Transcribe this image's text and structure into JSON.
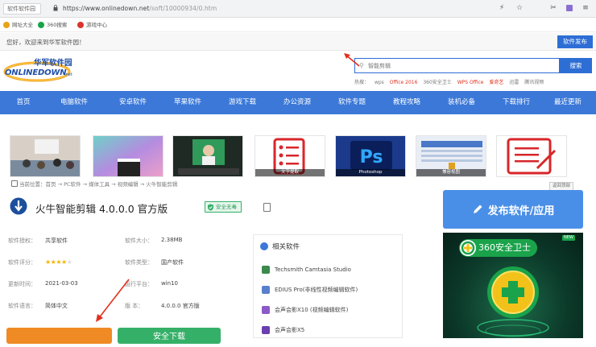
{
  "browser": {
    "tab_label": "软件软件园",
    "url_main": "https://www.onlinedown.net",
    "url_rest": "/soft/10000934/0.htm"
  },
  "bookmarks": [
    {
      "label": "网址大全",
      "color": "#e8a317"
    },
    {
      "label": "360搜索",
      "color": "#1aa34a"
    },
    {
      "label": "游戏中心",
      "color": "#d9342b"
    }
  ],
  "site_topbar": {
    "welcome": "您好，欢迎来到华军软件园！",
    "submit_label": "软件发布"
  },
  "logo": {
    "cn": "华军软件园",
    "en": "ONLINEDOWN",
    "suffix": ".net"
  },
  "search": {
    "placeholder": "智能剪辑",
    "button": "搜索",
    "hot_words": [
      {
        "text": "热搜：",
        "hot": false
      },
      {
        "text": "wps",
        "hot": false
      },
      {
        "text": "Office 2016",
        "hot": true
      },
      {
        "text": "360安全卫士",
        "hot": false
      },
      {
        "text": "WPS Office",
        "hot": true
      },
      {
        "text": "爱奇艺",
        "hot": false
      },
      {
        "text": "迅雷",
        "hot": false
      },
      {
        "text": "腾讯视频",
        "hot": false
      }
    ]
  },
  "nav": [
    "首页",
    "电脑软件",
    "安卓软件",
    "苹果软件",
    "游戏下载",
    "办公资源",
    "软件专题",
    "教程攻略",
    "装机必备",
    "下载排行",
    "最近更新"
  ],
  "banners": [
    {
      "caption": ""
    },
    {
      "caption": ""
    },
    {
      "caption": ""
    },
    {
      "caption": "文字提取"
    },
    {
      "caption": "Photoshop"
    },
    {
      "caption": "兼容视图"
    },
    {
      "caption": ""
    }
  ],
  "breadcrumb": "当前位置：首页 → PC软件 → 媒体工具 → 视频编辑 → 火牛智能剪辑",
  "top_back": "返回顶部",
  "software": {
    "title": "火牛智能剪辑  4.0.0.0 官方版",
    "safe_badge": "安全无毒",
    "rating": 4,
    "rating_max": 5
  },
  "info": [
    {
      "label": "软件授权：",
      "value": "共享软件"
    },
    {
      "label": "软件评分：",
      "value": ""
    },
    {
      "label": "更新时间：",
      "value": "2021-03-03"
    },
    {
      "label": "软件语言：",
      "value": "简体中文"
    },
    {
      "label": "软件大小：",
      "value": "2.38MB"
    },
    {
      "label": "软件类型：",
      "value": "国产软件"
    },
    {
      "label": "运行平台：",
      "value": "win10"
    },
    {
      "label": "版      本：",
      "value": "4.0.0.0 官方版"
    }
  ],
  "related": {
    "title": "相关软件",
    "items": [
      {
        "label": "Techsmith Camtasia Studio",
        "color": "#3a8b4d"
      },
      {
        "label": "EDIUS Pro(非线性视频编辑软件)",
        "color": "#5a7fcc"
      },
      {
        "label": "会声会影X10 (视频编辑软件)",
        "color": "#8b5ac8"
      },
      {
        "label": "会声会影X5",
        "color": "#6b3fb0"
      }
    ]
  },
  "download_buttons": {
    "download": "",
    "fast_download": "安全下载"
  },
  "publish": {
    "label": "发布软件/应用"
  },
  "ad": {
    "title": "360安全卫士",
    "new_tag": "NEW"
  },
  "colors": {
    "nav_bg": "#3b78d8",
    "search_blue": "#2d6ed5",
    "download_orange": "#f08a24",
    "safe_green": "#35b068",
    "publish_blue": "#4a8fe7",
    "arrow_red": "#e0301e"
  }
}
